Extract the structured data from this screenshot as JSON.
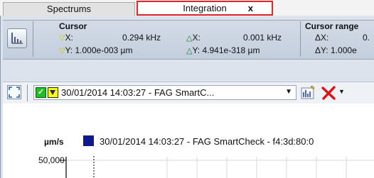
{
  "tabs": [
    {
      "label": "Spectrums",
      "active": false
    },
    {
      "label": "Integration",
      "active": true,
      "close_glyph": "x"
    }
  ],
  "cursor": {
    "title": "Cursor",
    "x_label": "X:",
    "x_value": "0.294 kHz",
    "dx_label": "X:",
    "dx_value": "0.001 kHz",
    "y_label": "Y:",
    "y_value": "1.000e-003 µm",
    "dy_label": "Y:",
    "dy_value": "4.941e-318 µm"
  },
  "cursor_range": {
    "title": "Cursor range",
    "dx_label": "ΔX:",
    "dx_value": "0.",
    "dy_label": "ΔY:",
    "dy_value": "1.000e"
  },
  "toolbar": {
    "selector_text": "30/01/2014 14:03:27 - FAG SmartC...",
    "checkbox_checked": true
  },
  "chart": {
    "unit": "µm/s",
    "legend": "30/01/2014 14:03:27 - FAG SmartCheck - f4:3d:80:0",
    "y_tick_top": "50,000",
    "series_color": "#0e1a8c",
    "cursor_color": "#000000",
    "grid": true
  },
  "colors": {
    "tab_highlight": "#e0262a",
    "cursor_marker": "#d8c600",
    "delta_marker": "#0a8a22"
  },
  "icons": {
    "cursor": "cursor-panel-icon",
    "fit": "fit-view-icon",
    "analysis": "spectrum-analysis-icon",
    "remove": "delete-x-icon"
  }
}
